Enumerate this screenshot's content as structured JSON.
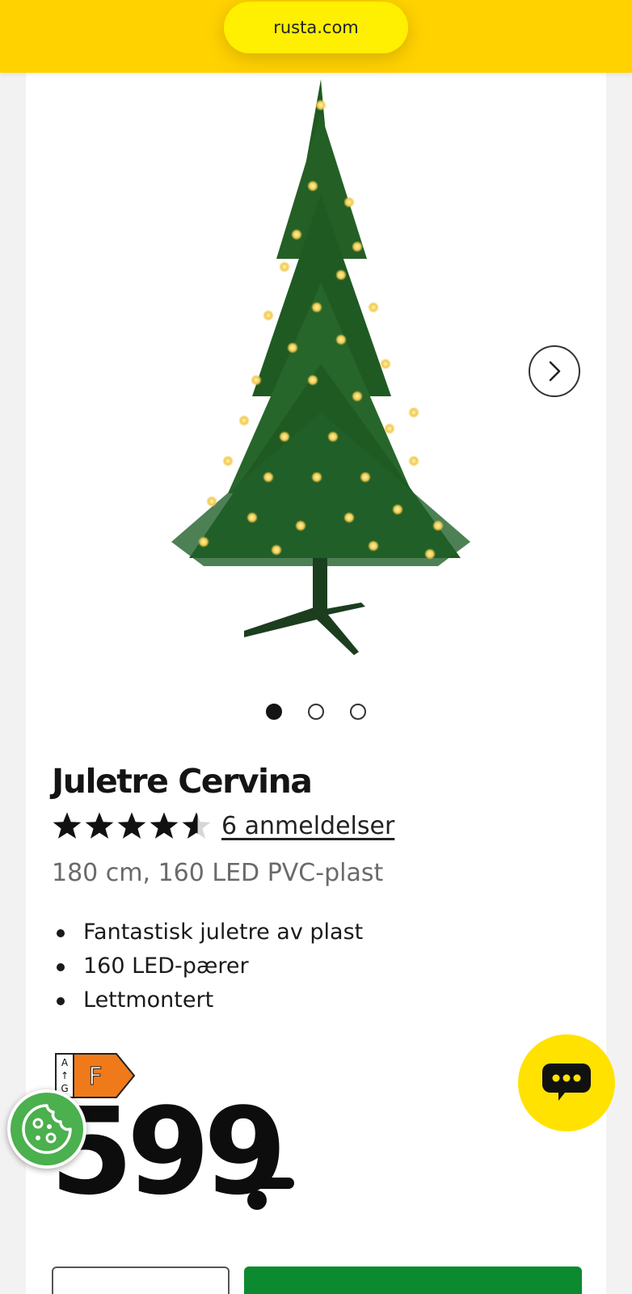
{
  "browser": {
    "url": "rusta.com"
  },
  "product": {
    "title": "Juletre Cervina",
    "rating": 4.5,
    "rating_max": 5,
    "reviews_label": "6 anmeldelser",
    "subtitle": "180 cm, 160 LED PVC-plast",
    "features": [
      "Fantastisk juletre av plast",
      "160 LED-pærer",
      "Lettmontert"
    ],
    "energy_label": {
      "scale": "A↑G",
      "class": "F"
    },
    "price": "599"
  },
  "gallery": {
    "image_count": 3,
    "active_index": 0,
    "next_icon": "chevron-right-icon"
  },
  "colors": {
    "topbar": "#ffd200",
    "buy_button": "#0b8a2f",
    "chat_button": "#ffe200",
    "cookie_button": "#4bb04e",
    "energy_class": "#f07a1a"
  },
  "icons": {
    "chat": "chat-bubble-icon",
    "cookie": "cookie-icon"
  }
}
